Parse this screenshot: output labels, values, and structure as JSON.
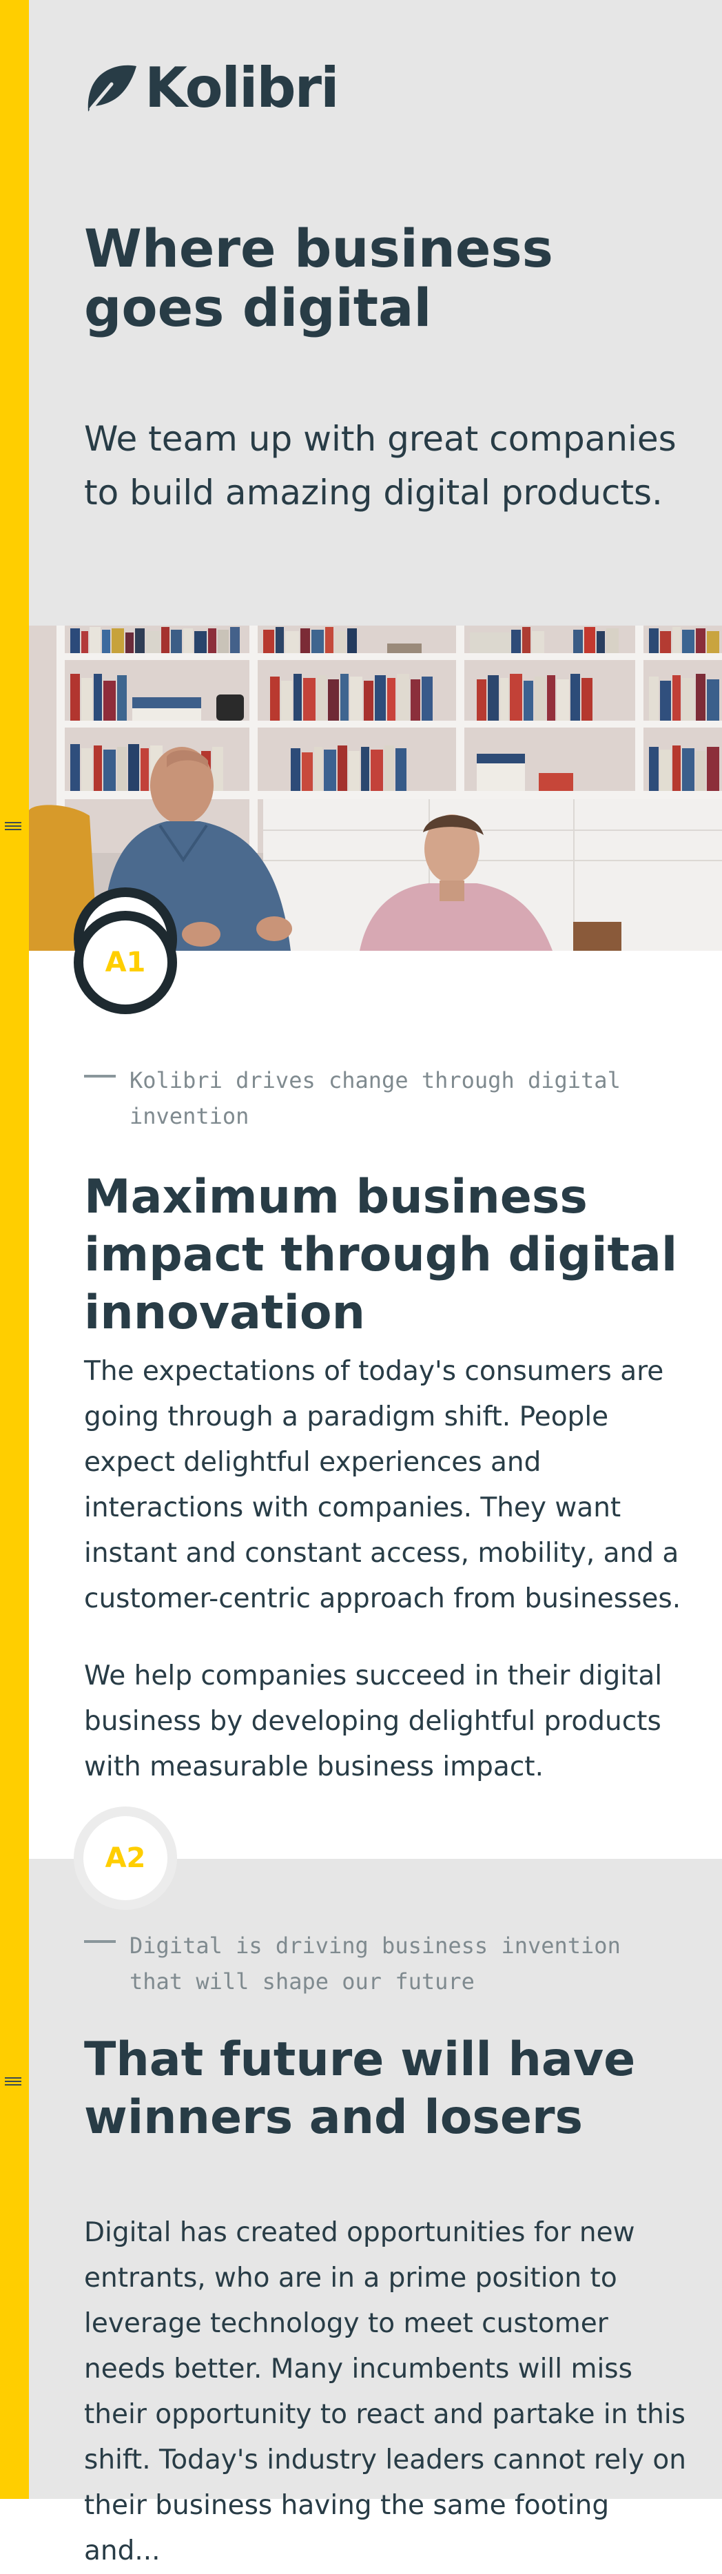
{
  "nav": {
    "menu_icon": "hamburger-menu-icon"
  },
  "brand": {
    "name": "Kolibri",
    "logo_icon": "kolibri-leaf-logo-icon"
  },
  "hero": {
    "title": "Where business goes digital",
    "subtitle": "We team up with great companies to build amazing digital products."
  },
  "photo": {
    "alt": "Two men in a meeting in front of a bookshelf"
  },
  "sections": [
    {
      "badge": "A1",
      "kicker": "Kolibri drives change through digital invention",
      "title": "Maximum business impact through digital innovation",
      "paragraphs": [
        "The expectations of today's consumers are going through a paradigm shift. People expect delightful experiences and interactions with companies. They want instant and constant access, mobility, and a customer-centric approach from businesses.",
        "We help companies succeed in their digital business by developing delightful products with measurable business impact."
      ]
    },
    {
      "badge": "A2",
      "kicker": "Digital is driving business invention that will shape our future",
      "title": "That future will have winners and losers",
      "paragraphs": [
        "Digital has created opportunities for new entrants, who are in a prime position to leverage technology to meet customer needs better. Many incumbents will miss their opportunity to react and partake in this shift. Today's industry leaders cannot rely on their business having the same footing and..."
      ]
    }
  ],
  "colors": {
    "accent": "#ffce00",
    "text": "#283c46",
    "muted": "#7f8a8f",
    "hero_bg": "#e6e6e6"
  }
}
